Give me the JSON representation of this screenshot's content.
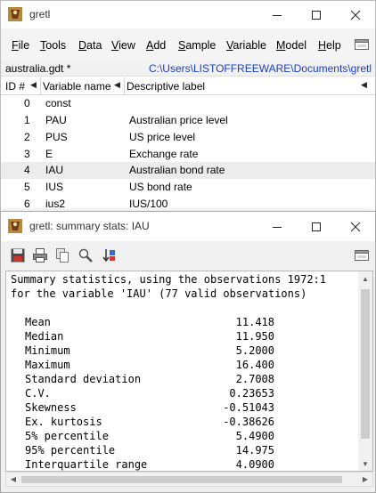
{
  "main_window": {
    "title": "gretl",
    "menu": [
      "File",
      "Tools",
      "Data",
      "View",
      "Add",
      "Sample",
      "Variable",
      "Model",
      "Help"
    ],
    "file_name": "australia.gdt *",
    "file_path": "C:\\Users\\LISTOFFREEWARE\\Documents\\gretl",
    "columns": {
      "id": "ID #",
      "name": "Variable name",
      "label": "Descriptive label"
    },
    "variables": [
      {
        "id": "0",
        "name": "const",
        "label": ""
      },
      {
        "id": "1",
        "name": "PAU",
        "label": "Australian price level"
      },
      {
        "id": "2",
        "name": "PUS",
        "label": "US price level"
      },
      {
        "id": "3",
        "name": "E",
        "label": "Exchange rate"
      },
      {
        "id": "4",
        "name": "IAU",
        "label": "Australian bond rate"
      },
      {
        "id": "5",
        "name": "IUS",
        "label": "US bond rate"
      },
      {
        "id": "6",
        "name": "ius2",
        "label": "IUS/100"
      }
    ],
    "selected_variable": "IAU"
  },
  "summary_window": {
    "title": "gretl: summary stats: IAU",
    "header_lines": [
      "Summary statistics, using the observations 1972:1",
      "for the variable 'IAU' (77 valid observations)"
    ],
    "stats": [
      {
        "label": "Mean",
        "value": "11.418"
      },
      {
        "label": "Median",
        "value": "11.950"
      },
      {
        "label": "Minimum",
        "value": "5.2000"
      },
      {
        "label": "Maximum",
        "value": "16.400"
      },
      {
        "label": "Standard deviation",
        "value": "2.7008"
      },
      {
        "label": "C.V.",
        "value": "0.23653"
      },
      {
        "label": "Skewness",
        "value": "-0.51043"
      },
      {
        "label": "Ex. kurtosis",
        "value": "-0.38626"
      },
      {
        "label": "5% percentile",
        "value": "5.4900"
      },
      {
        "label": "95% percentile",
        "value": "14.975"
      },
      {
        "label": "Interquartile range",
        "value": "4.0900"
      }
    ]
  },
  "colors": {
    "path_link": "#1a3ec8",
    "selected_row": "#ececec",
    "menubar_bg": "#f4f4f4"
  },
  "icons": [
    "gretl-app-icon",
    "minimize-icon",
    "maximize-icon",
    "close-icon",
    "toolbar-icon",
    "save-icon",
    "print-icon",
    "copy-icon",
    "find-icon",
    "sort-icon"
  ]
}
